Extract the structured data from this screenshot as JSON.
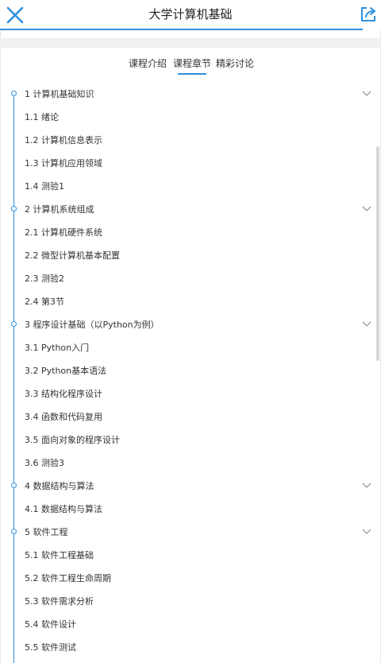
{
  "header": {
    "title": "大学计算机基础",
    "accent_color": "#2d8fdd",
    "close_icon": "close-icon",
    "share_icon": "share-icon"
  },
  "tabs": [
    {
      "label": "课程介绍",
      "active": false
    },
    {
      "label": "课程章节",
      "active": true
    },
    {
      "label": "精彩讨论",
      "active": false
    }
  ],
  "chapters": [
    {
      "label": "1 计算机基础知识",
      "sections": [
        "1.1 绪论",
        "1.2 计算机信息表示",
        "1.3 计算机应用领域",
        "1.4 测验1"
      ]
    },
    {
      "label": "2 计算机系统组成",
      "sections": [
        "2.1 计算机硬件系统",
        "2.2 微型计算机基本配置",
        "2.3 测验2",
        "2.4 第3节"
      ]
    },
    {
      "label": "3 程序设计基础（以Python为例）",
      "sections": [
        "3.1 Python入门",
        "3.2 Python基本语法",
        "3.3 结构化程序设计",
        "3.4 函数和代码复用",
        "3.5 面向对象的程序设计",
        "3.6 测验3"
      ]
    },
    {
      "label": "4 数据结构与算法",
      "sections": [
        "4.1 数据结构与算法"
      ]
    },
    {
      "label": "5 软件工程",
      "sections": [
        "5.1 软件工程基础",
        "5.2 软件工程生命周期",
        "5.3 软件需求分析",
        "5.4 软件设计",
        "5.5 软件测试"
      ]
    }
  ]
}
